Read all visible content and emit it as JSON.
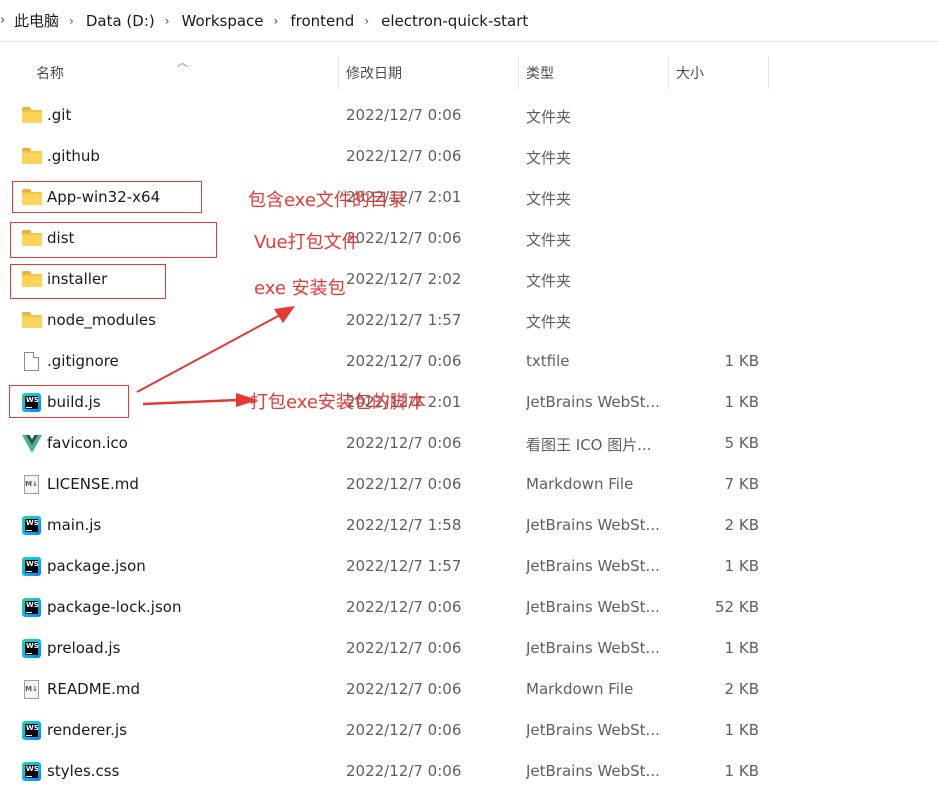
{
  "breadcrumb": {
    "items": [
      "此电脑",
      "Data (D:)",
      "Workspace",
      "frontend",
      "electron-quick-start"
    ]
  },
  "columns": {
    "name": "名称",
    "date": "修改日期",
    "type": "类型",
    "size": "大小"
  },
  "files": [
    {
      "name": ".git",
      "date": "2022/12/7 0:06",
      "type": "文件夹",
      "size": "",
      "icon": "folder-icon"
    },
    {
      "name": ".github",
      "date": "2022/12/7 0:06",
      "type": "文件夹",
      "size": "",
      "icon": "folder-icon"
    },
    {
      "name": "App-win32-x64",
      "date": "2022/12/7 2:01",
      "type": "文件夹",
      "size": "",
      "icon": "folder-icon"
    },
    {
      "name": "dist",
      "date": "2022/12/7 0:06",
      "type": "文件夹",
      "size": "",
      "icon": "folder-icon"
    },
    {
      "name": "installer",
      "date": "2022/12/7 2:02",
      "type": "文件夹",
      "size": "",
      "icon": "folder-icon"
    },
    {
      "name": "node_modules",
      "date": "2022/12/7 1:57",
      "type": "文件夹",
      "size": "",
      "icon": "folder-icon"
    },
    {
      "name": ".gitignore",
      "date": "2022/12/7 0:06",
      "type": "txtfile",
      "size": "1 KB",
      "icon": "text-file-icon"
    },
    {
      "name": "build.js",
      "date": "2022/12/7 2:01",
      "type": "JetBrains WebSt...",
      "size": "1 KB",
      "icon": "webstorm-file-icon"
    },
    {
      "name": "favicon.ico",
      "date": "2022/12/7 0:06",
      "type": "看图王 ICO 图片...",
      "size": "5 KB",
      "icon": "vue-logo-icon"
    },
    {
      "name": "LICENSE.md",
      "date": "2022/12/7 0:06",
      "type": "Markdown File",
      "size": "7 KB",
      "icon": "markdown-file-icon"
    },
    {
      "name": "main.js",
      "date": "2022/12/7 1:58",
      "type": "JetBrains WebSt...",
      "size": "2 KB",
      "icon": "webstorm-file-icon"
    },
    {
      "name": "package.json",
      "date": "2022/12/7 1:57",
      "type": "JetBrains WebSt...",
      "size": "1 KB",
      "icon": "webstorm-file-icon"
    },
    {
      "name": "package-lock.json",
      "date": "2022/12/7 0:06",
      "type": "JetBrains WebSt...",
      "size": "52 KB",
      "icon": "webstorm-file-icon"
    },
    {
      "name": "preload.js",
      "date": "2022/12/7 0:06",
      "type": "JetBrains WebSt...",
      "size": "1 KB",
      "icon": "webstorm-file-icon"
    },
    {
      "name": "README.md",
      "date": "2022/12/7 0:06",
      "type": "Markdown File",
      "size": "2 KB",
      "icon": "markdown-file-icon"
    },
    {
      "name": "renderer.js",
      "date": "2022/12/7 0:06",
      "type": "JetBrains WebSt...",
      "size": "1 KB",
      "icon": "webstorm-file-icon"
    },
    {
      "name": "styles.css",
      "date": "2022/12/7 0:06",
      "type": "JetBrains WebSt...",
      "size": "1 KB",
      "icon": "webstorm-file-icon"
    }
  ],
  "annotations": {
    "app_folder_note": "包含exe文件的目录",
    "dist_note": "Vue打包文件",
    "installer_note": "exe 安装包",
    "build_note": "打包exe安装包的脚本"
  },
  "colors": {
    "annotation_red": "#e53935",
    "folder_yellow": "#f6c444"
  },
  "icons": {
    "md_badge": "M↓",
    "ws_badge": "WS"
  }
}
